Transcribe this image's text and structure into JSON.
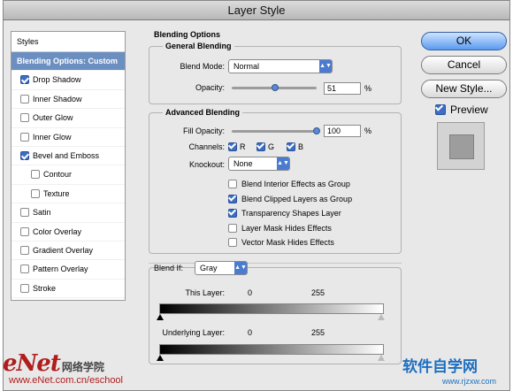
{
  "window": {
    "title": "Layer Style"
  },
  "styles_panel": {
    "header": "Styles",
    "items": [
      {
        "label": "Blending Options: Custom",
        "selected": true,
        "checkbox": false
      },
      {
        "label": "Drop Shadow",
        "checked": true
      },
      {
        "label": "Inner Shadow",
        "checked": false
      },
      {
        "label": "Outer Glow",
        "checked": false
      },
      {
        "label": "Inner Glow",
        "checked": false
      },
      {
        "label": "Bevel and Emboss",
        "checked": true
      },
      {
        "label": "Contour",
        "checked": false,
        "sub": true
      },
      {
        "label": "Texture",
        "checked": false,
        "sub": true
      },
      {
        "label": "Satin",
        "checked": false
      },
      {
        "label": "Color Overlay",
        "checked": false
      },
      {
        "label": "Gradient Overlay",
        "checked": false
      },
      {
        "label": "Pattern Overlay",
        "checked": false
      },
      {
        "label": "Stroke",
        "checked": false
      }
    ]
  },
  "blending_options": {
    "title": "Blending Options",
    "general": {
      "title": "General Blending",
      "blend_mode_label": "Blend Mode:",
      "blend_mode_value": "Normal",
      "opacity_label": "Opacity:",
      "opacity_value": "51",
      "opacity_fraction": 0.51,
      "unit": "%"
    },
    "advanced": {
      "title": "Advanced Blending",
      "fill_opacity_label": "Fill Opacity:",
      "fill_opacity_value": "100",
      "fill_opacity_fraction": 1.0,
      "unit": "%",
      "channels_label": "Channels:",
      "channels": [
        {
          "label": "R",
          "checked": true
        },
        {
          "label": "G",
          "checked": true
        },
        {
          "label": "B",
          "checked": true
        }
      ],
      "knockout_label": "Knockout:",
      "knockout_value": "None",
      "options": [
        {
          "label": "Blend Interior Effects as Group",
          "checked": false
        },
        {
          "label": "Blend Clipped Layers as Group",
          "checked": true
        },
        {
          "label": "Transparency Shapes Layer",
          "checked": true
        },
        {
          "label": "Layer Mask Hides Effects",
          "checked": false
        },
        {
          "label": "Vector Mask Hides Effects",
          "checked": false
        }
      ]
    },
    "blend_if": {
      "label": "Blend If:",
      "value": "Gray",
      "this_layer_label": "This Layer:",
      "this_layer_min": "0",
      "this_layer_max": "255",
      "underlying_label": "Underlying Layer:",
      "underlying_min": "0",
      "underlying_max": "255"
    }
  },
  "buttons": {
    "ok": "OK",
    "cancel": "Cancel",
    "new_style": "New Style...",
    "preview_label": "Preview",
    "preview_checked": true
  },
  "watermarks": {
    "left_logo": "eNet",
    "left_cn": "网络学院",
    "left_url": "www.eNet.com.cn/eschool",
    "right_logo": "软件自学网",
    "right_url": "www.rjzxw.com"
  },
  "colors": {
    "selection": "#6b8fc0",
    "accent_blue": "#4a7bd0",
    "watermark_red": "#b01d1d",
    "watermark_blue": "#1d6fbf"
  }
}
